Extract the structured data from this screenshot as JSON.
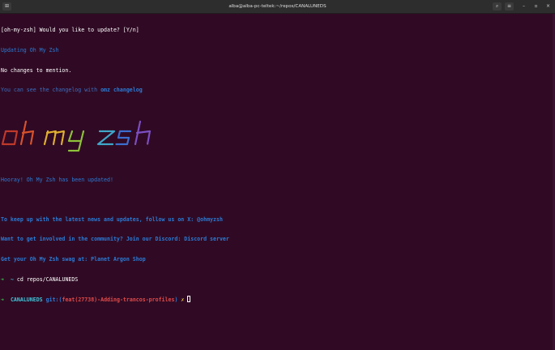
{
  "window": {
    "title": "alba@alba-pc-teltek:~/repos/CANALUNEDS",
    "new_tab_icon": "new-tab-icon",
    "search_icon": "search-icon",
    "menu_icon": "hamburger-menu-icon",
    "min_glyph": "–",
    "max_glyph": "▫",
    "close_glyph": "×"
  },
  "terminal": {
    "l1": "[oh-my-zsh] Would you like to update? [Y/n]",
    "l2": "Updating Oh My Zsh",
    "l3": "No changes to mention.",
    "l4a": "You can see the changelog with",
    "l4b": "omz changelog",
    "ascii_art_label": "oh my zsh",
    "l6a": "Hooray! Oh My Zsh has been updated!",
    "l7a": "To keep up with the latest news and updates, follow us on X:",
    "l7b": "@ohmyzsh",
    "l8a": "Want to get involved in the community? Join our Discord:",
    "l8b": "Discord server",
    "l9a": "Get your Oh My Zsh swag at:",
    "l9b": "Planet Argon Shop",
    "p1_arrow": "➜",
    "p1_dir": "~",
    "p1_cmd": "cd repos/CANALUNEDS",
    "p2_arrow": "➜",
    "p2_dir": "CANALUNEDS",
    "p2_git": "git:(",
    "p2_branch": "feat(27738)-Adding-trancos-profiles",
    "p2_close": ")",
    "p2_dirty": "✗"
  },
  "colors": {
    "background": "#300a24",
    "titlebar": "#2d2d2d",
    "prompt_green": "#33c94a",
    "dir_cyan": "#3fc3d8",
    "branch_red": "#e04a4a",
    "dirty_yellow": "#e6c84a",
    "info_blue": "#2a7bd6"
  }
}
